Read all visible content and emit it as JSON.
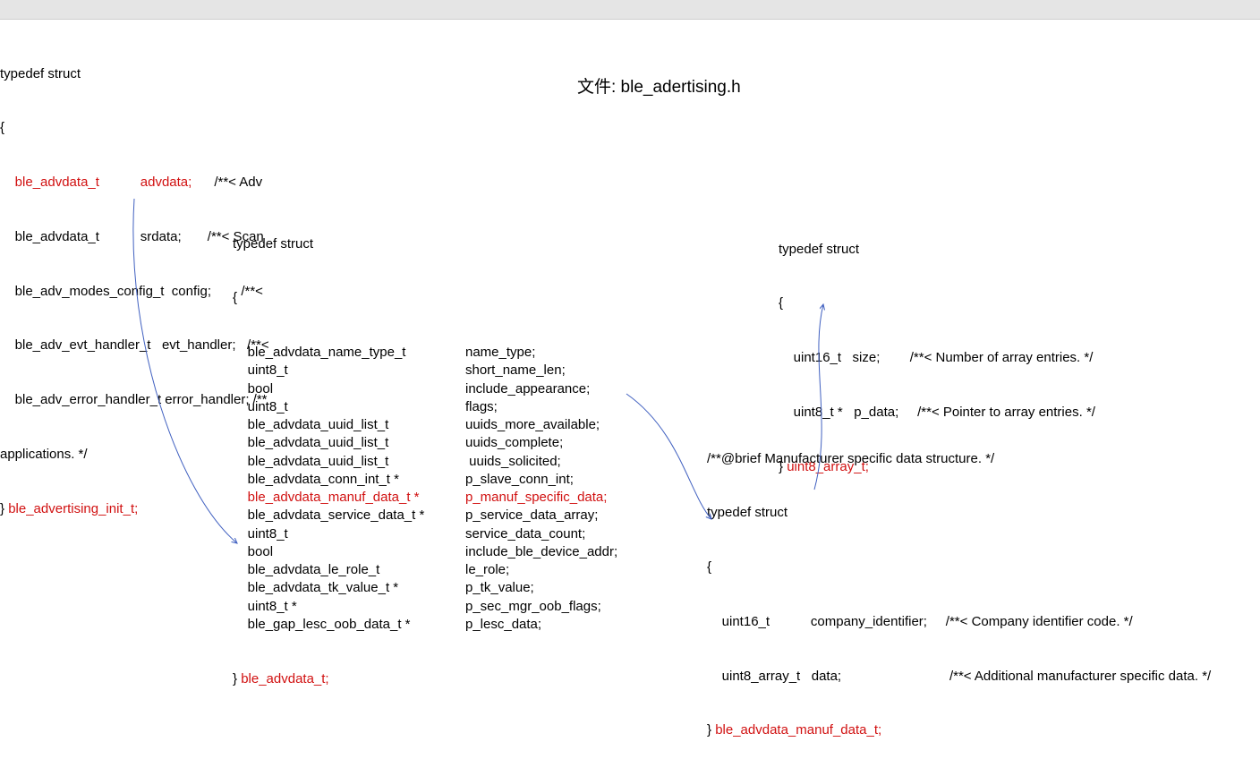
{
  "title": "文件: ble_adertising.h",
  "struct1": {
    "typedef": "typedef struct",
    "open": "{",
    "l1type": "ble_advdata_t",
    "l1name": "advdata;",
    "l1cmt": "/**< Adv",
    "l2": "    ble_advdata_t           srdata;       /**< Scan",
    "l3": "    ble_adv_modes_config_t  config;        /**<",
    "l4": "    ble_adv_evt_handler_t   evt_handler;   /**<",
    "l5": "    ble_adv_error_handler_t error_handler; /**",
    "l6": "applications. */",
    "close": "} ",
    "name": "ble_advertising_init_t;"
  },
  "struct2": {
    "typedef": "typedef struct",
    "open": "{",
    "rows": [
      [
        "    ble_advdata_name_type_t",
        "name_type;",
        false
      ],
      [
        "    uint8_t",
        "short_name_len;",
        false
      ],
      [
        "    bool",
        "include_appearance;",
        false
      ],
      [
        "    uint8_t",
        "flags;",
        false
      ],
      [
        "    ble_advdata_uuid_list_t",
        "uuids_more_available;",
        false
      ],
      [
        "    ble_advdata_uuid_list_t",
        "uuids_complete;",
        false
      ],
      [
        "    ble_advdata_uuid_list_t",
        " uuids_solicited;",
        false
      ],
      [
        "    ble_advdata_conn_int_t *",
        "p_slave_conn_int;",
        false
      ],
      [
        "    ble_advdata_manuf_data_t *",
        "p_manuf_specific_data;",
        true
      ],
      [
        "    ble_advdata_service_data_t *",
        "p_service_data_array;",
        false
      ],
      [
        "    uint8_t",
        "service_data_count;",
        false
      ],
      [
        "    bool",
        "include_ble_device_addr;",
        false
      ],
      [
        "    ble_advdata_le_role_t",
        "le_role;",
        false
      ],
      [
        "    ble_advdata_tk_value_t *",
        "p_tk_value;",
        false
      ],
      [
        "    uint8_t *",
        "p_sec_mgr_oob_flags;",
        false
      ],
      [
        "    ble_gap_lesc_oob_data_t *",
        "p_lesc_data;",
        false
      ]
    ],
    "close": "} ",
    "name": "ble_advdata_t;"
  },
  "struct3": {
    "typedef": "typedef struct",
    "open": "{",
    "l1": "    uint16_t   size;        /**< Number of array entries. */",
    "l2": "    uint8_t *   p_data;     /**< Pointer to array entries. */",
    "close": "} ",
    "name": "uint8_array_t;"
  },
  "struct4": {
    "brief": "/**@brief Manufacturer specific data structure. */",
    "typedef": "typedef struct",
    "open": "{",
    "l1": "    uint16_t           company_identifier;     /**< Company identifier code. */",
    "l2": "    uint8_array_t   data;                             /**< Additional manufacturer specific data. */",
    "close": "} ",
    "name": "ble_advdata_manuf_data_t;"
  }
}
